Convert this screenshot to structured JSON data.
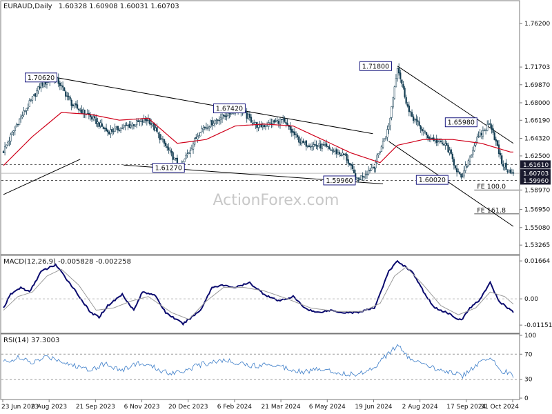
{
  "header": {
    "title": "EURAUD,Daily",
    "ohlc": "1.60328 1.60908 1.60031 1.60703"
  },
  "watermark": "ActionForex.com",
  "colors": {
    "candle": "#163f54",
    "sma": "#d0021b",
    "trend": "#000000",
    "channel": "#555555",
    "hline": "#555555",
    "macd": "#0a0a6e",
    "signal": "#9a9a9a",
    "rsi": "#3a7cc8",
    "label_border": "#1a1a80",
    "tag_bg": "#1a1a2e"
  },
  "chart_data": [
    {
      "type": "candlestick",
      "title": "EURAUD,Daily",
      "ylim": [
        1.5235,
        1.785
      ],
      "ticks": [
        "1.76200",
        "1.71703",
        "1.69870",
        "1.68000",
        "1.66190",
        "1.64320",
        "1.62500",
        "1.60703",
        "1.58970",
        "1.56950",
        "1.55080",
        "1.53265"
      ],
      "x_labels": [
        "23 Jun 2023",
        "8 Aug 2023",
        "21 Sep 2023",
        "6 Nov 2023",
        "20 Dec 2023",
        "6 Feb 2024",
        "21 Mar 2024",
        "6 May 2024",
        "19 Jun 2024",
        "2 Aug 2024",
        "17 Sep 2024",
        "31 Oct 2024"
      ],
      "anchors": [
        {
          "bar": 0,
          "price": 1.63
        },
        {
          "bar": 10,
          "price": 1.66
        },
        {
          "bar": 26,
          "price": 1.699
        },
        {
          "bar": 36,
          "price": 1.7062
        },
        {
          "bar": 48,
          "price": 1.677
        },
        {
          "bar": 58,
          "price": 1.668
        },
        {
          "bar": 72,
          "price": 1.65
        },
        {
          "bar": 86,
          "price": 1.656
        },
        {
          "bar": 100,
          "price": 1.663
        },
        {
          "bar": 112,
          "price": 1.635
        },
        {
          "bar": 122,
          "price": 1.6127
        },
        {
          "bar": 136,
          "price": 1.652
        },
        {
          "bar": 150,
          "price": 1.665
        },
        {
          "bar": 162,
          "price": 1.6742
        },
        {
          "bar": 176,
          "price": 1.655
        },
        {
          "bar": 192,
          "price": 1.662
        },
        {
          "bar": 206,
          "price": 1.638
        },
        {
          "bar": 220,
          "price": 1.635
        },
        {
          "bar": 236,
          "price": 1.625
        },
        {
          "bar": 244,
          "price": 1.5996
        },
        {
          "bar": 256,
          "price": 1.615
        },
        {
          "bar": 266,
          "price": 1.655
        },
        {
          "bar": 272,
          "price": 1.718
        },
        {
          "bar": 280,
          "price": 1.67
        },
        {
          "bar": 292,
          "price": 1.646
        },
        {
          "bar": 306,
          "price": 1.635
        },
        {
          "bar": 316,
          "price": 1.6002
        },
        {
          "bar": 326,
          "price": 1.64
        },
        {
          "bar": 336,
          "price": 1.6598
        },
        {
          "bar": 344,
          "price": 1.618
        },
        {
          "bar": 350,
          "price": 1.607
        }
      ],
      "sma": [
        {
          "bar": 0,
          "price": 1.615
        },
        {
          "bar": 20,
          "price": 1.645
        },
        {
          "bar": 40,
          "price": 1.67
        },
        {
          "bar": 60,
          "price": 1.668
        },
        {
          "bar": 80,
          "price": 1.662
        },
        {
          "bar": 100,
          "price": 1.664
        },
        {
          "bar": 120,
          "price": 1.638
        },
        {
          "bar": 140,
          "price": 1.642
        },
        {
          "bar": 160,
          "price": 1.656
        },
        {
          "bar": 180,
          "price": 1.658
        },
        {
          "bar": 200,
          "price": 1.656
        },
        {
          "bar": 220,
          "price": 1.642
        },
        {
          "bar": 240,
          "price": 1.628
        },
        {
          "bar": 260,
          "price": 1.618
        },
        {
          "bar": 272,
          "price": 1.636
        },
        {
          "bar": 290,
          "price": 1.642
        },
        {
          "bar": 310,
          "price": 1.642
        },
        {
          "bar": 330,
          "price": 1.638
        },
        {
          "bar": 350,
          "price": 1.629
        }
      ],
      "trend_lines": [
        {
          "from": {
            "bar": 36,
            "price": 1.7062
          },
          "to": {
            "bar": 255,
            "price": 1.648
          }
        },
        {
          "from": {
            "bar": 83,
            "price": 1.6155
          },
          "to": {
            "bar": 262,
            "price": 1.596
          }
        },
        {
          "from": {
            "bar": 0,
            "price": 1.585
          },
          "to": {
            "bar": 53,
            "price": 1.6215
          }
        },
        {
          "from": {
            "bar": 272,
            "price": 1.718
          },
          "to": {
            "bar": 352,
            "price": 1.638
          }
        },
        {
          "from": {
            "bar": 266,
            "price": 1.64
          },
          "to": {
            "bar": 352,
            "price": 1.552
          }
        }
      ],
      "h_lines": [
        {
          "price": 1.6161,
          "style": "dashed"
        },
        {
          "price": 1.607,
          "style": "solid"
        },
        {
          "price": 1.5996,
          "style": "dashed"
        },
        {
          "price": 1.5897,
          "style": "partial",
          "from_bar": 325,
          "label": "FE 100.0"
        },
        {
          "price": 1.565,
          "style": "partial",
          "from_bar": 325,
          "label": "FE 161.8"
        }
      ],
      "annotations": [
        {
          "text": "1.70620",
          "bar": 15,
          "price": 1.7062
        },
        {
          "text": "1.67420",
          "bar": 145,
          "price": 1.6742
        },
        {
          "text": "1.61270",
          "bar": 103,
          "price": 1.6127
        },
        {
          "text": "1.59960",
          "bar": 221,
          "price": 1.5996
        },
        {
          "text": "1.71800",
          "bar": 246,
          "price": 1.718
        },
        {
          "text": "1.60020",
          "bar": 285,
          "price": 1.6002
        },
        {
          "text": "1.65980",
          "bar": 305,
          "price": 1.6598
        }
      ],
      "price_tags": [
        {
          "text": "1.61610",
          "price": 1.6161
        },
        {
          "text": "1.60703",
          "price": 1.607
        },
        {
          "text": "1.59960",
          "price": 1.5996
        }
      ]
    },
    {
      "type": "line",
      "title": "MACD(12,26,9) -0.005828 -0.002258",
      "ylim": [
        -0.0145,
        0.0185
      ],
      "ticks": [
        {
          "text": "0.01664",
          "value": 0.01664
        },
        {
          "text": "0.00",
          "value": 0.0
        },
        {
          "text": "-0.011515",
          "value": -0.011515
        }
      ],
      "series": [
        {
          "name": "MACD",
          "points": [
            {
              "bar": 0,
              "value": -0.004
            },
            {
              "bar": 5,
              "value": 0.002
            },
            {
              "bar": 12,
              "value": 0.005
            },
            {
              "bar": 18,
              "value": 0.003
            },
            {
              "bar": 26,
              "value": 0.012
            },
            {
              "bar": 36,
              "value": 0.015
            },
            {
              "bar": 48,
              "value": 0.005
            },
            {
              "bar": 60,
              "value": -0.006
            },
            {
              "bar": 66,
              "value": -0.008
            },
            {
              "bar": 72,
              "value": -0.003
            },
            {
              "bar": 82,
              "value": 0.002
            },
            {
              "bar": 90,
              "value": -0.005
            },
            {
              "bar": 96,
              "value": 0.003
            },
            {
              "bar": 104,
              "value": 0.002
            },
            {
              "bar": 112,
              "value": -0.006
            },
            {
              "bar": 124,
              "value": -0.011
            },
            {
              "bar": 136,
              "value": -0.005
            },
            {
              "bar": 144,
              "value": 0.005
            },
            {
              "bar": 150,
              "value": 0.006
            },
            {
              "bar": 160,
              "value": 0.005
            },
            {
              "bar": 170,
              "value": 0.007
            },
            {
              "bar": 180,
              "value": 0.002
            },
            {
              "bar": 190,
              "value": -0.001
            },
            {
              "bar": 200,
              "value": 0.001
            },
            {
              "bar": 208,
              "value": -0.004
            },
            {
              "bar": 216,
              "value": -0.006
            },
            {
              "bar": 226,
              "value": -0.005
            },
            {
              "bar": 234,
              "value": -0.006
            },
            {
              "bar": 244,
              "value": -0.006
            },
            {
              "bar": 256,
              "value": -0.004
            },
            {
              "bar": 266,
              "value": 0.012
            },
            {
              "bar": 272,
              "value": 0.0166
            },
            {
              "bar": 282,
              "value": 0.012
            },
            {
              "bar": 292,
              "value": 0.001
            },
            {
              "bar": 298,
              "value": -0.004
            },
            {
              "bar": 306,
              "value": -0.006
            },
            {
              "bar": 316,
              "value": -0.0095
            },
            {
              "bar": 322,
              "value": -0.004
            },
            {
              "bar": 328,
              "value": -0.001
            },
            {
              "bar": 336,
              "value": 0.007
            },
            {
              "bar": 342,
              "value": -0.001
            },
            {
              "bar": 352,
              "value": -0.0058
            }
          ]
        },
        {
          "name": "Signal",
          "points": [
            {
              "bar": 0,
              "value": -0.005
            },
            {
              "bar": 10,
              "value": 0.001
            },
            {
              "bar": 20,
              "value": 0.003
            },
            {
              "bar": 30,
              "value": 0.01
            },
            {
              "bar": 40,
              "value": 0.013
            },
            {
              "bar": 52,
              "value": 0.006
            },
            {
              "bar": 64,
              "value": -0.005
            },
            {
              "bar": 76,
              "value": -0.004
            },
            {
              "bar": 88,
              "value": -0.001
            },
            {
              "bar": 100,
              "value": 0.001
            },
            {
              "bar": 116,
              "value": -0.006
            },
            {
              "bar": 128,
              "value": -0.009
            },
            {
              "bar": 140,
              "value": -0.001
            },
            {
              "bar": 152,
              "value": 0.005
            },
            {
              "bar": 166,
              "value": 0.005
            },
            {
              "bar": 180,
              "value": 0.0035
            },
            {
              "bar": 196,
              "value": 0.0
            },
            {
              "bar": 212,
              "value": -0.004
            },
            {
              "bar": 230,
              "value": -0.0055
            },
            {
              "bar": 248,
              "value": -0.0055
            },
            {
              "bar": 260,
              "value": -0.002
            },
            {
              "bar": 270,
              "value": 0.01
            },
            {
              "bar": 278,
              "value": 0.014
            },
            {
              "bar": 290,
              "value": 0.006
            },
            {
              "bar": 302,
              "value": -0.003
            },
            {
              "bar": 314,
              "value": -0.007
            },
            {
              "bar": 326,
              "value": -0.004
            },
            {
              "bar": 336,
              "value": 0.003
            },
            {
              "bar": 346,
              "value": 0.001
            },
            {
              "bar": 352,
              "value": -0.0023
            }
          ]
        }
      ]
    },
    {
      "type": "line",
      "title": "RSI(14) 37.3003",
      "ylim": [
        0,
        100
      ],
      "ticks": [
        {
          "text": "100",
          "value": 100
        },
        {
          "text": "70",
          "value": 70
        },
        {
          "text": "30",
          "value": 30
        },
        {
          "text": "0",
          "value": 0
        }
      ],
      "series": [
        {
          "name": "RSI",
          "points": [
            {
              "bar": 0,
              "value": 58
            },
            {
              "bar": 10,
              "value": 64
            },
            {
              "bar": 20,
              "value": 56
            },
            {
              "bar": 30,
              "value": 66
            },
            {
              "bar": 36,
              "value": 63
            },
            {
              "bar": 48,
              "value": 52
            },
            {
              "bar": 60,
              "value": 46
            },
            {
              "bar": 70,
              "value": 55
            },
            {
              "bar": 82,
              "value": 44
            },
            {
              "bar": 92,
              "value": 56
            },
            {
              "bar": 102,
              "value": 50
            },
            {
              "bar": 114,
              "value": 40
            },
            {
              "bar": 124,
              "value": 44
            },
            {
              "bar": 136,
              "value": 53
            },
            {
              "bar": 148,
              "value": 60
            },
            {
              "bar": 160,
              "value": 58
            },
            {
              "bar": 172,
              "value": 51
            },
            {
              "bar": 184,
              "value": 55
            },
            {
              "bar": 196,
              "value": 48
            },
            {
              "bar": 208,
              "value": 42
            },
            {
              "bar": 220,
              "value": 47
            },
            {
              "bar": 232,
              "value": 40
            },
            {
              "bar": 244,
              "value": 37
            },
            {
              "bar": 256,
              "value": 50
            },
            {
              "bar": 266,
              "value": 72
            },
            {
              "bar": 272,
              "value": 83
            },
            {
              "bar": 280,
              "value": 64
            },
            {
              "bar": 290,
              "value": 52
            },
            {
              "bar": 300,
              "value": 46
            },
            {
              "bar": 310,
              "value": 42
            },
            {
              "bar": 316,
              "value": 34
            },
            {
              "bar": 326,
              "value": 52
            },
            {
              "bar": 336,
              "value": 64
            },
            {
              "bar": 344,
              "value": 44
            },
            {
              "bar": 352,
              "value": 37
            }
          ]
        }
      ]
    }
  ]
}
